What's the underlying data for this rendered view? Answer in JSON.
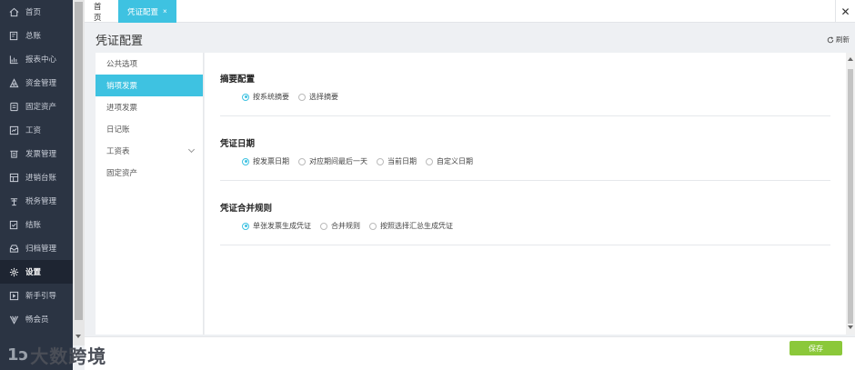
{
  "nav": {
    "items": [
      {
        "label": "首页",
        "icon": "home-icon"
      },
      {
        "label": "总账",
        "icon": "ledger-icon"
      },
      {
        "label": "报表中心",
        "icon": "chart-icon"
      },
      {
        "label": "资金管理",
        "icon": "money-icon"
      },
      {
        "label": "固定资产",
        "icon": "asset-icon"
      },
      {
        "label": "工资",
        "icon": "salary-icon"
      },
      {
        "label": "发票管理",
        "icon": "invoice-icon"
      },
      {
        "label": "进销台账",
        "icon": "stock-icon"
      },
      {
        "label": "税务管理",
        "icon": "tax-icon"
      },
      {
        "label": "结账",
        "icon": "checkout-icon"
      },
      {
        "label": "归档管理",
        "icon": "archive-icon"
      },
      {
        "label": "设置",
        "icon": "gear-icon",
        "active": true
      },
      {
        "label": "新手引导",
        "icon": "guide-icon"
      },
      {
        "label": "畅会员",
        "icon": "vip-icon"
      }
    ]
  },
  "tabs": {
    "home": "首页",
    "current": "凭证配置",
    "close_symbol": "×",
    "close_all": "✕"
  },
  "page": {
    "title": "凭证配置",
    "refresh": "刷新"
  },
  "sub_menu": {
    "items": [
      "公共选项",
      "销项发票",
      "进项发票",
      "日记账",
      "工资表",
      "固定资产"
    ],
    "active_index": 1
  },
  "sections": [
    {
      "title": "摘要配置",
      "options": [
        "按系统摘要",
        "选择摘要"
      ],
      "selected": 0
    },
    {
      "title": "凭证日期",
      "options": [
        "按发票日期",
        "对应期间最后一天",
        "当前日期",
        "自定义日期"
      ],
      "selected": 0
    },
    {
      "title": "凭证合并规则",
      "options": [
        "单张发票生成凭证",
        "合并规则",
        "按照选择汇总生成凭证"
      ],
      "selected": 0
    }
  ],
  "footer": {
    "save_label": "保存"
  },
  "watermark": {
    "logo": "1ↄ",
    "text": "大数跨境"
  },
  "colors": {
    "accent": "#3ec2e1",
    "nav_bg": "#2b3443",
    "save": "#8bc83a"
  }
}
